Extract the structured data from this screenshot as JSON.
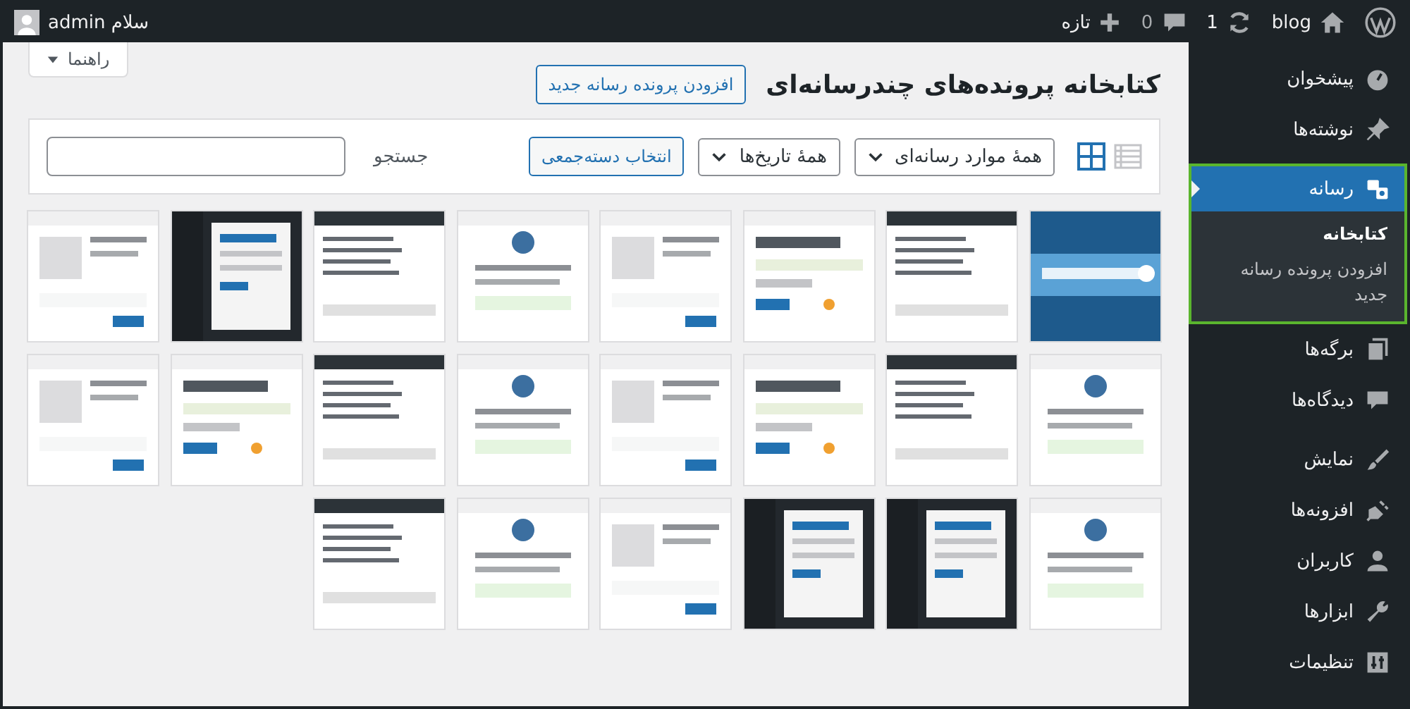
{
  "admin_bar": {
    "site": "blog",
    "updates": "1",
    "comments": "0",
    "new": "تازه",
    "greeting": "سلام admin"
  },
  "sidebar": {
    "items": [
      {
        "label": "پیشخوان",
        "selected": false,
        "highlighted": false
      },
      {
        "label": "نوشته‌ها",
        "selected": false,
        "highlighted": false
      },
      {
        "label": "رسانه",
        "selected": true,
        "highlighted": true,
        "children": [
          {
            "label": "کتابخانه",
            "selected": true
          },
          {
            "label": "افزودن پرونده رسانه جدید",
            "selected": false
          }
        ]
      },
      {
        "label": "برگه‌ها",
        "selected": false,
        "highlighted": false
      },
      {
        "label": "دیدگاه‌ها",
        "selected": false,
        "highlighted": false
      },
      {
        "label": "نمایش",
        "selected": false,
        "highlighted": false
      },
      {
        "label": "افزونه‌ها",
        "selected": false,
        "highlighted": false
      },
      {
        "label": "کاربران",
        "selected": false,
        "highlighted": false
      },
      {
        "label": "ابزارها",
        "selected": false,
        "highlighted": false
      },
      {
        "label": "تنظیمات",
        "selected": false,
        "highlighted": false
      }
    ]
  },
  "help_tab": "راهنما",
  "page_title": "کتابخانه پرونده‌های چندرسانه‌ای",
  "add_new_button": "افزودن پرونده رسانه جدید",
  "toolbar": {
    "views": [
      {
        "kind": "list",
        "selected": false
      },
      {
        "kind": "grid",
        "selected": true
      }
    ],
    "type_filter": "همهٔ موارد رسانه‌ای",
    "date_filter": "همهٔ تاریخ‌ها",
    "bulk_select_button": "انتخاب دسته‌جمعی",
    "search_label": "جستجو"
  }
}
